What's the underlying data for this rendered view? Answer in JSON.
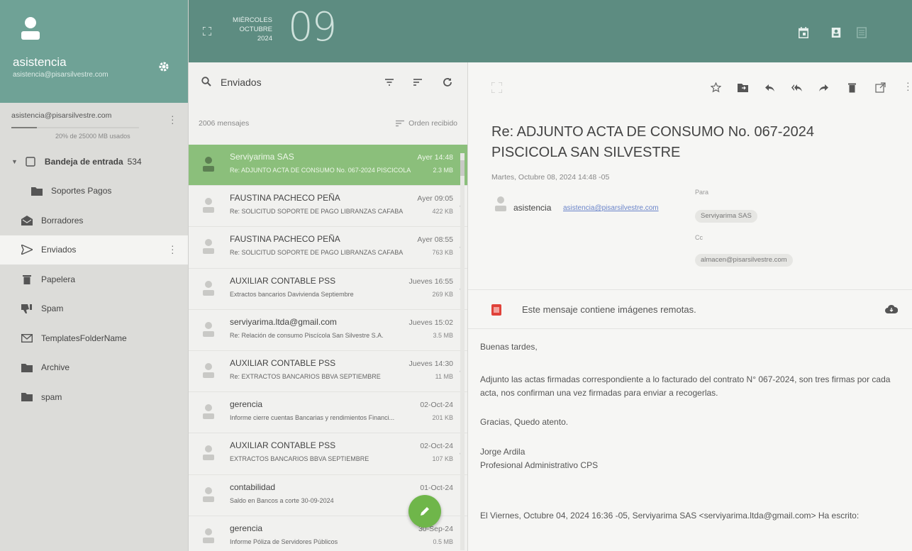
{
  "account": {
    "name": "asistencia",
    "email": "asistencia@pisarsilvestre.com",
    "quota_email": "asistencia@pisarsilvestre.com",
    "quota_text": "20% de 25000 MB usados",
    "quota_fraction": 0.2
  },
  "folders": [
    {
      "label": "Bandeja de entrada",
      "count": "534",
      "icon": "inbox-icon",
      "name": "inbox"
    },
    {
      "label": "Soportes Pagos",
      "icon": "folder-icon",
      "name": "soportes-pagos"
    },
    {
      "label": "Borradores",
      "icon": "drafts-icon",
      "name": "drafts"
    },
    {
      "label": "Enviados",
      "icon": "send-icon",
      "name": "sent"
    },
    {
      "label": "Papelera",
      "icon": "trash-icon",
      "name": "trash"
    },
    {
      "label": "Spam",
      "icon": "thumbs-down-icon",
      "name": "spam"
    },
    {
      "label": "TemplatesFolderName",
      "icon": "mail-icon",
      "name": "templates"
    },
    {
      "label": "Archive",
      "icon": "folder-icon",
      "name": "archive"
    },
    {
      "label": "spam",
      "icon": "folder-icon",
      "name": "spam-folder"
    }
  ],
  "topbar": {
    "weekday": "MIÉRCOLES",
    "month": "OCTUBRE",
    "year": "2024",
    "day": "09"
  },
  "list": {
    "folder_title": "Enviados",
    "message_count": "2006 mensajes",
    "order_label": "Orden recibido",
    "messages": [
      {
        "sender": "Serviyarima SAS",
        "date": "Ayer 14:48",
        "subject": "Re: ADJUNTO ACTA DE CONSUMO No. 067-2024 PISCICOLA SAN SILVESTRE",
        "size": "2.3 MB",
        "selected": true
      },
      {
        "sender": "FAUSTINA PACHECO PEÑA",
        "date": "Ayer 09:05",
        "subject": "Re: SOLICITUD SOPORTE DE PAGO LIBRANZAS CAFABA",
        "size": "422 KB"
      },
      {
        "sender": "FAUSTINA PACHECO PEÑA",
        "date": "Ayer 08:55",
        "subject": "Re: SOLICITUD SOPORTE DE PAGO LIBRANZAS CAFABA",
        "size": "763 KB"
      },
      {
        "sender": "AUXILIAR CONTABLE PSS",
        "date": "Jueves 16:55",
        "subject": "Extractos bancarios Davivienda Septiembre",
        "size": "269 KB"
      },
      {
        "sender": "serviyarima.ltda@gmail.com",
        "date": "Jueves 15:02",
        "subject": "Re: Relación de consumo Piscícola San Silvestre S.A.",
        "size": "3.5 MB"
      },
      {
        "sender": "AUXILIAR CONTABLE PSS",
        "date": "Jueves 14:30",
        "subject": "Re: EXTRACTOS BANCARIOS BBVA SEPTIEMBRE",
        "size": "11 MB"
      },
      {
        "sender": "gerencia",
        "date": "02-Oct-24",
        "subject": "Informe cierre cuentas Bancarias y rendimientos Financi...",
        "size": "201 KB"
      },
      {
        "sender": "AUXILIAR CONTABLE PSS",
        "date": "02-Oct-24",
        "subject": "EXTRACTOS BANCARIOS BBVA SEPTIEMBRE",
        "size": "107 KB"
      },
      {
        "sender": "contabilidad",
        "date": "01-Oct-24",
        "subject": "Saldo en Bancos a corte 30-09-2024",
        "size": "",
        "no_date": true
      },
      {
        "sender": "gerencia",
        "date": "30-Sep-24",
        "subject": "Informe Póliza de Servidores Públicos",
        "size": "0.5 MB"
      }
    ]
  },
  "reader": {
    "subject": "Re: ADJUNTO ACTA DE CONSUMO No. 067-2024 PISCICOLA SAN SILVESTRE",
    "sent_date": "Martes, Octubre 08, 2024 14:48 -05",
    "from_name": "asistencia",
    "from_email": "asistencia@pisarsilvestre.com",
    "to_label": "Para",
    "to_chip": "Serviyarima SAS",
    "cc_label": "Cc",
    "cc_chip": "almacen@pisarsilvestre.com",
    "remote_notice": "Este mensaje contiene imágenes remotas.",
    "body": [
      "Buenas tardes,",
      "Adjunto las actas firmadas correspondiente a lo facturado del contrato N° 067-2024, son tres firmas por cada acta, nos confirman una vez firmadas para enviar a recogerlas.",
      "Gracias, Quedo atento.",
      "Jorge Ardila",
      "Profesional Administrativo CPS",
      "El Viernes, Octubre 04, 2024 16:36 -05, Serviyarima SAS <serviyarima.ltda@gmail.com> Ha escrito:"
    ]
  },
  "colors": {
    "accent": "#5d8c81",
    "account_header": "#6fa296",
    "selected_row": "#8bbf7b",
    "fab": "#6fb64a",
    "remote_icon": "#e0423a"
  }
}
